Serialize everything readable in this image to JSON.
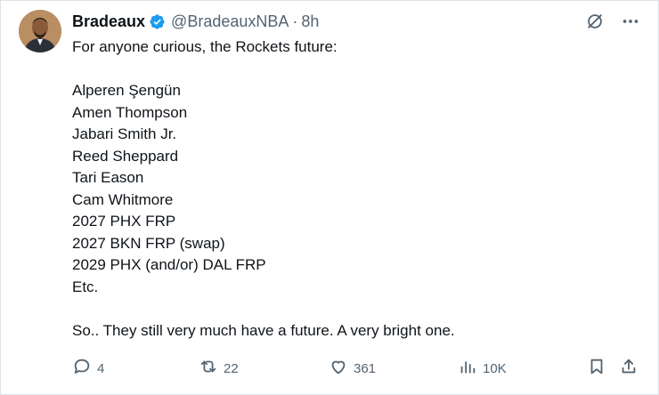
{
  "tweet": {
    "display_name": "Bradeaux",
    "handle": "@BradeauxNBA",
    "separator": "·",
    "time": "8h",
    "verified": true,
    "lines": [
      "For anyone curious, the Rockets future:",
      "",
      "Alperen Şengün",
      "Amen Thompson",
      "Jabari Smith Jr.",
      "Reed Sheppard",
      "Tari Eason",
      "Cam Whitmore",
      "2027 PHX FRP",
      "2027 BKN FRP (swap)",
      "2029 PHX (and/or) DAL FRP",
      "Etc.",
      "",
      "So.. They still very much have a future. A very bright one."
    ]
  },
  "actions": {
    "replies": "4",
    "reposts": "22",
    "likes": "361",
    "views": "10K"
  },
  "colors": {
    "text": "#0f1419",
    "muted": "#536471",
    "verified": "#1d9bf0"
  },
  "icons": {
    "top": [
      "grok-icon",
      "more-icon"
    ],
    "actions": [
      "reply-icon",
      "repost-icon",
      "like-icon",
      "views-icon",
      "bookmark-icon",
      "share-icon"
    ]
  }
}
